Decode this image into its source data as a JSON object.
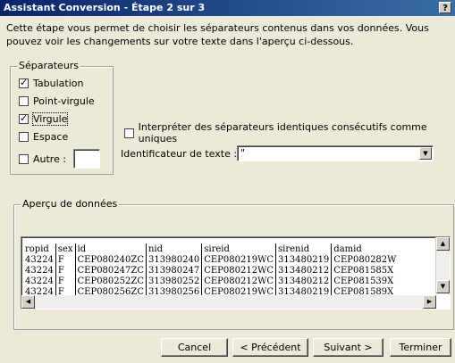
{
  "window": {
    "title": "Assistant Conversion - Étape 2 sur 3",
    "help_label": "?"
  },
  "description": "Cette étape vous permet de choisir les séparateurs contenus dans vos données. Vous pouvez voir les changements sur votre texte dans l'aperçu ci-dessous.",
  "separators": {
    "legend": "Séparateurs",
    "items": [
      {
        "label": "Tabulation",
        "checked": true
      },
      {
        "label": "Point-virgule",
        "checked": false
      },
      {
        "label": "Virgule",
        "checked": true
      },
      {
        "label": "Espace",
        "checked": false
      },
      {
        "label": "Autre :",
        "checked": false
      }
    ]
  },
  "consecutive": {
    "label": "Interpréter des séparateurs identiques consécutifs comme uniques",
    "checked": false
  },
  "text_qualifier": {
    "label": "Identificateur de texte :",
    "value": "\""
  },
  "preview": {
    "legend": "Aperçu de données",
    "columns": [
      "ropid",
      "sex",
      "id",
      "nid",
      "sireid",
      "sirenid",
      "damid"
    ],
    "rows": [
      [
        "43224",
        "F",
        "CEP080240ZC",
        "313980240",
        "CEP080219WC",
        "313480219",
        "CEP080282W"
      ],
      [
        "43224",
        "F",
        "CEP080247ZC",
        "313980247",
        "CEP080212WC",
        "313480212",
        "CEP081585X"
      ],
      [
        "43224",
        "F",
        "CEP080252ZC",
        "313980252",
        "CEP080212WC",
        "313480212",
        "CEP081539X"
      ],
      [
        "43224",
        "F",
        "CEP080256ZC",
        "313980256",
        "CEP080219WC",
        "313480219",
        "CEP081589X"
      ]
    ]
  },
  "buttons": {
    "cancel": "Cancel",
    "previous": "< Précédent",
    "next": "Suivant >",
    "finish": "Terminer"
  }
}
